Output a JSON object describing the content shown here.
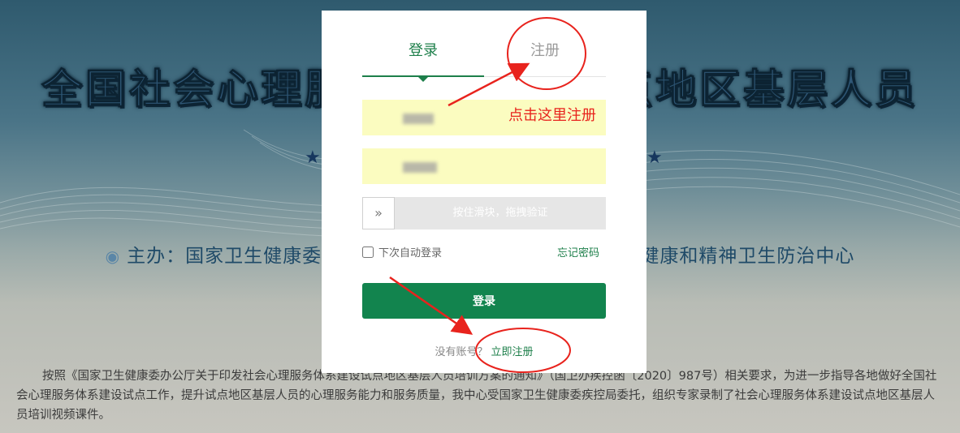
{
  "background": {
    "title": "全国社会心理服务体系建设试点地区基层人员",
    "sponsor_label": "主办：国家卫生健康委疾病预防控制局  国家卫生健康委心理健康和精神卫生防治中心",
    "description": "按照《国家卫生健康委办公厅关于印发社会心理服务体系建设试点地区基层人员培训方案的通知》（国卫办疾控函〔2020〕987号）相关要求，为进一步指导各地做好全国社会心理服务体系建设试点工作，提升试点地区基层人员的心理服务能力和服务质量，我中心受国家卫生健康委疾控局委托，组织专家录制了社会心理服务体系建设试点地区基层人员培训视频课件。"
  },
  "modal": {
    "tabs": [
      {
        "label": "登录",
        "active": true
      },
      {
        "label": "注册",
        "active": false
      }
    ],
    "slider_text": "按住滑块，拖拽验证",
    "slider_handle": "»",
    "remember_label": "下次自动登录",
    "forgot_label": "忘记密码",
    "login_button": "登录",
    "no_account_label": "没有账号？",
    "register_now_label": "立即注册"
  },
  "annotation": {
    "hint_text": "点击这里注册",
    "color": "#e8231d"
  },
  "colors": {
    "brand_green": "#12844e",
    "input_bg": "#fbfcc0"
  }
}
